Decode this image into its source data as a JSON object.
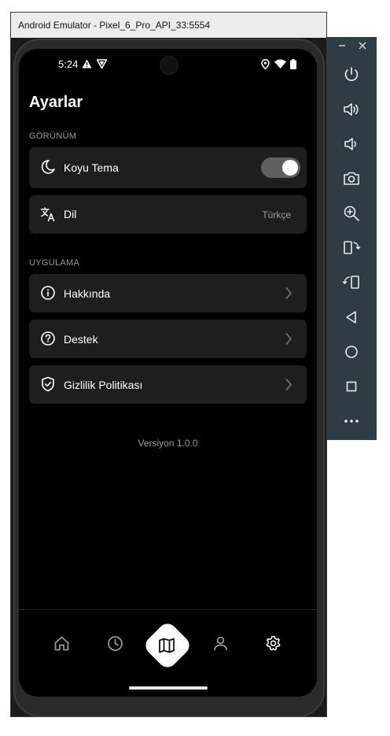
{
  "window": {
    "title": "Android Emulator - Pixel_6_Pro_API_33:5554"
  },
  "status_bar": {
    "time": "5:24"
  },
  "page": {
    "title": "Ayarlar"
  },
  "sections": {
    "appearance": "GÖRÜNÜM",
    "application": "UYGULAMA"
  },
  "settings": {
    "dark_theme": {
      "label": "Koyu Tema",
      "enabled": true
    },
    "language": {
      "label": "Dil",
      "value": "Türkçe"
    },
    "about": {
      "label": "Hakkında"
    },
    "support": {
      "label": "Destek"
    },
    "privacy": {
      "label": "Gizlilik Politikası"
    }
  },
  "version": "Versiyon 1.0.0",
  "bottom_nav": {
    "items": [
      "home-icon",
      "history-icon",
      "map-icon",
      "profile-icon",
      "settings-icon"
    ],
    "active": "map-icon"
  },
  "emulator_panel": {
    "window_controls": [
      "minimize-icon",
      "close-icon"
    ],
    "buttons": [
      "power-icon",
      "volume-up-icon",
      "volume-down-icon",
      "camera-icon",
      "zoom-icon",
      "rotate-left-icon",
      "rotate-right-icon",
      "back-icon",
      "home-icon",
      "overview-icon",
      "more-icon"
    ]
  },
  "colors": {
    "background": "#000000",
    "card": "#1e1e1e",
    "emulator_panel": "#2e3c43",
    "accent": "#ffffff"
  }
}
